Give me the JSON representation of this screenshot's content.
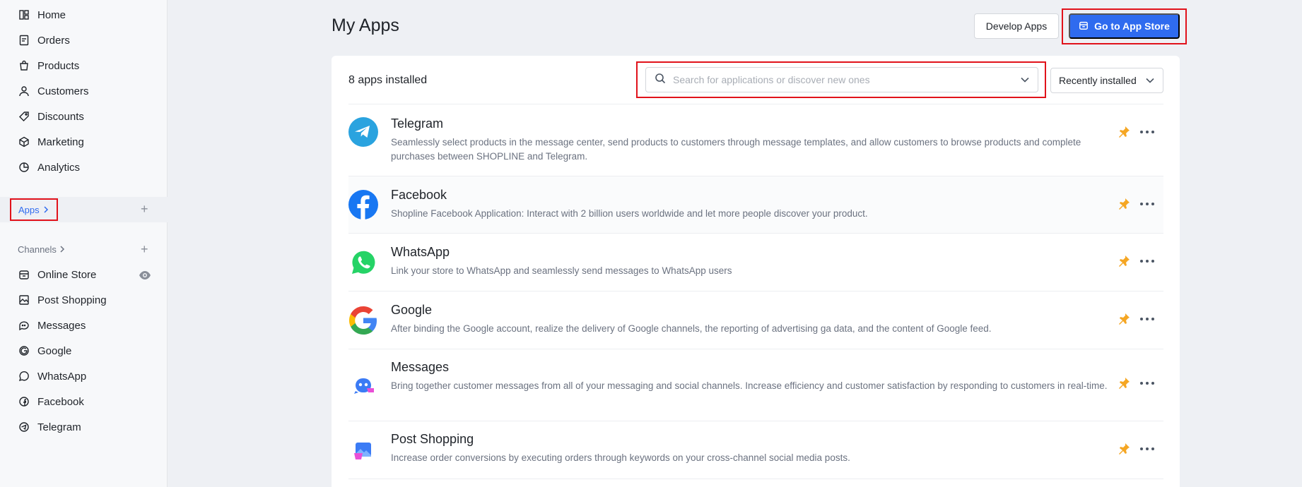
{
  "sidebar": {
    "nav": [
      {
        "label": "Home",
        "icon": "home-icon"
      },
      {
        "label": "Orders",
        "icon": "orders-icon"
      },
      {
        "label": "Products",
        "icon": "products-icon"
      },
      {
        "label": "Customers",
        "icon": "customers-icon"
      },
      {
        "label": "Discounts",
        "icon": "discounts-icon"
      },
      {
        "label": "Marketing",
        "icon": "marketing-icon"
      },
      {
        "label": "Analytics",
        "icon": "analytics-icon"
      }
    ],
    "apps_label": "Apps",
    "channels_label": "Channels",
    "channels": [
      {
        "label": "Online Store",
        "icon": "store-icon"
      },
      {
        "label": "Post Shopping",
        "icon": "post-shopping-icon"
      },
      {
        "label": "Messages",
        "icon": "messages-icon"
      },
      {
        "label": "Google",
        "icon": "google-icon"
      },
      {
        "label": "WhatsApp",
        "icon": "whatsapp-icon"
      },
      {
        "label": "Facebook",
        "icon": "facebook-icon"
      },
      {
        "label": "Telegram",
        "icon": "telegram-icon"
      }
    ]
  },
  "header": {
    "title": "My Apps",
    "develop_label": "Develop Apps",
    "store_label": "Go to App Store"
  },
  "list": {
    "count_label": "8 apps installed",
    "search_placeholder": "Search for applications or discover new ones",
    "sort_label": "Recently installed",
    "apps": [
      {
        "name": "Telegram",
        "desc": "Seamlessly select products in the message center, send products to customers through message templates, and allow customers to browse products and complete purchases between SHOPLINE and Telegram."
      },
      {
        "name": "Facebook",
        "desc": "Shopline Facebook Application: Interact with 2 billion users worldwide and let more people discover your product."
      },
      {
        "name": "WhatsApp",
        "desc": "Link your store to WhatsApp and seamlessly send messages to WhatsApp users"
      },
      {
        "name": "Google",
        "desc": "After binding the Google account, realize the delivery of Google channels, the reporting of advertising ga data, and the content of Google feed."
      },
      {
        "name": "Messages",
        "desc": "Bring together customer messages from all of your messaging and social channels. Increase efficiency and customer satisfaction by responding to customers in real-time."
      },
      {
        "name": "Post Shopping",
        "desc": "Increase order conversions by executing orders through keywords on your cross-channel social media posts."
      }
    ]
  },
  "colors": {
    "accent": "#2f6bef",
    "highlight": "#e1121b",
    "pin": "#f5a623"
  }
}
